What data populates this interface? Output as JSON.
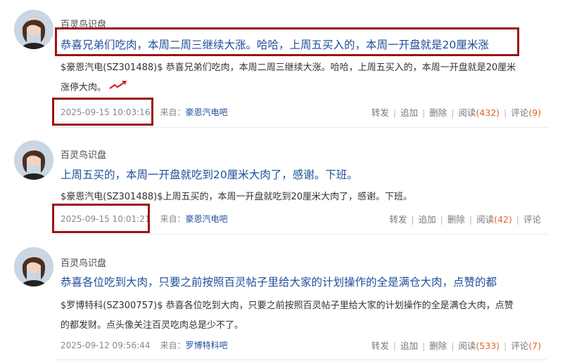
{
  "posts": [
    {
      "username": "百灵鸟识盘",
      "title": "恭喜兄弟们吃肉，本周二周三继续大涨。哈哈，上周五买入的，本周一开盘就是20厘米涨",
      "body_line1": "$豪恩汽电(SZ301488)$ 恭喜兄弟们吃肉，本周二周三继续大涨。哈哈，上周五买入的，本周一开盘就是20厘米",
      "body_line2": "涨停大肉。",
      "timestamp": "2025-09-15 10:03:16",
      "from_label": "来自：",
      "from_link": "豪恩汽电吧",
      "actions": {
        "forward": "转发",
        "append": "追加",
        "delete": "删除",
        "read": "阅读",
        "read_count": "(432)",
        "comment": "评论",
        "comment_count": "(9)"
      }
    },
    {
      "username": "百灵鸟识盘",
      "title": "上周五买的，本周一开盘就吃到20厘米大肉了，感谢。下班。",
      "body_line1": "$豪恩汽电(SZ301488)$上周五买的，本周一开盘就吃到20厘米大肉了，感谢。下班。",
      "timestamp": "2025-09-15 10:01:21",
      "from_label": "来自：",
      "from_link": "豪恩汽电吧",
      "actions": {
        "forward": "转发",
        "append": "追加",
        "delete": "删除",
        "read": "阅读",
        "read_count": "(42)",
        "comment": "评论"
      }
    },
    {
      "username": "百灵鸟识盘",
      "title": "恭喜各位吃到大肉，只要之前按照百灵帖子里给大家的计划操作的全是满仓大肉，点赞的都",
      "body_line1": "$罗博特科(SZ300757)$ 恭喜各位吃到大肉，只要之前按照百灵帖子里给大家的计划操作的全是满仓大肉，点赞",
      "body_line2": "的都发财。点头像关注百灵吃肉总是少不了。",
      "timestamp": "2025-09-12 09:56:44",
      "from_label": "来自：",
      "from_link": "罗博特科吧",
      "actions": {
        "forward": "转发",
        "append": "追加",
        "delete": "删除",
        "read": "阅读",
        "read_count": "(533)",
        "comment": "评论",
        "comment_count": "(7)"
      }
    }
  ],
  "icons": {
    "avatar": "avatar-photo",
    "trend": "red-up-arrow-icon"
  },
  "colors": {
    "title": "#1d4f9a",
    "count": "#e0641f",
    "highlight": "#9a1414"
  }
}
